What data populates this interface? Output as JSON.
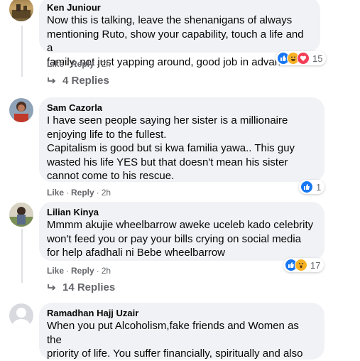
{
  "comments": [
    {
      "author": "Ken Juniour",
      "text": "Now this is talking, leave the shenanigans of always\nmentioning Ruto, show your capability, touch a life and a\nfamily, not just yapping around, good job in advance",
      "actions": {
        "like": "Like",
        "reply": "Reply",
        "time": "2h"
      },
      "reaction_icons": [
        "like-icon",
        "haha-icon",
        "love-icon"
      ],
      "reaction_count": "15",
      "replies_label": "4 Replies"
    },
    {
      "author": "Sam Cazorla",
      "text": "I have seen people saying her sister is a millionaire\nenjoying life to the fullest.\nCapitalism is good but si kwa familia yawa.. This guy\nwasted his life YES but that doesn't mean his sister\ncannot come to his rescue.",
      "actions": {
        "like": "Like",
        "reply": "Reply",
        "time": "2h"
      },
      "reaction_icons": [
        "like-icon"
      ],
      "reaction_count": "1"
    },
    {
      "author": "Lilian Kinya",
      "text": "Mmmm akujie wheelbarrow aweke uceleb kado celebrity\nwon't feed you or pay your bills crying on social media\nfor help afadhali ni Bebe wheelbarrow",
      "actions": {
        "like": "Like",
        "reply": "Reply",
        "time": "2h"
      },
      "reaction_icons": [
        "like-icon",
        "wow-icon"
      ],
      "reaction_count": "17",
      "replies_label": "14 Replies"
    },
    {
      "author": "Ramadhan Hajj Uzair",
      "text": "When you put Alcoholism,fake friends and Women as the\npriority of life. You suffer financially, spiritually and also"
    }
  ],
  "colors": {
    "bubble": "#f0f2f5",
    "meta": "#65676b",
    "like": "#1877f2",
    "love": "#f33e58",
    "haha": "#f7b125"
  }
}
